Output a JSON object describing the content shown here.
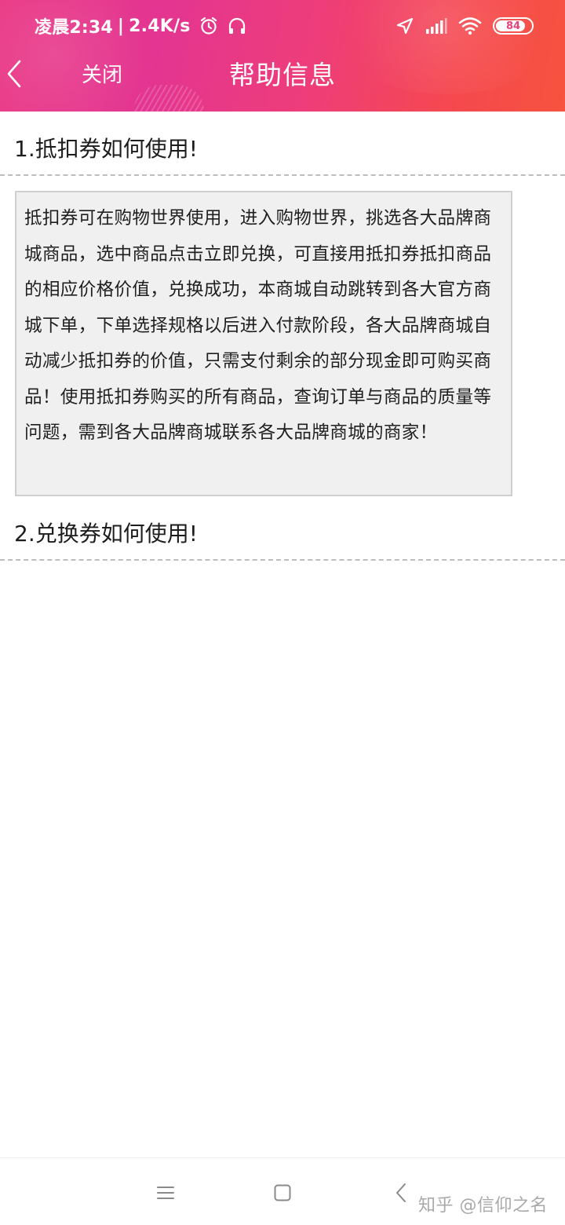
{
  "status_bar": {
    "time": "凌晨2:34",
    "separator": "|",
    "net_speed": "2.4K/s",
    "battery_level": "84",
    "battery_fraction": 0.84
  },
  "nav": {
    "close_label": "关闭",
    "title": "帮助信息"
  },
  "faq": [
    {
      "question": "1.抵扣券如何使用!",
      "answer": "抵扣券可在购物世界使用，进入购物世界，挑选各大品牌商城商品，选中商品点击立即兑换，可直接用抵扣券抵扣商品的相应价格价值，兑换成功，本商城自动跳转到各大官方商城下单，下单选择规格以后进入付款阶段，各大品牌商城自动减少抵扣券的价值，只需支付剩余的部分现金即可购买商品！使用抵扣券购买的所有商品，查询订单与商品的质量等问题，需到各大品牌商城联系各大品牌商城的商家！"
    },
    {
      "question": "2.兑换券如何使用!"
    }
  ],
  "watermark": "知乎 @信仰之名",
  "icons": {
    "status": [
      "alarm-icon",
      "headset-icon",
      "location-arrow-icon",
      "signal-icon",
      "wifi-icon",
      "battery-icon"
    ],
    "nav": [
      "back-arrow-icon"
    ],
    "system": [
      "menu-icon",
      "home-square-icon",
      "back-icon"
    ]
  },
  "colors": {
    "header_gradient_start": "#ea3a86",
    "header_gradient_end": "#f7533f",
    "answer_background": "#f0f0f0",
    "answer_border": "#cfcfcf",
    "divider": "#bdbdbd"
  }
}
